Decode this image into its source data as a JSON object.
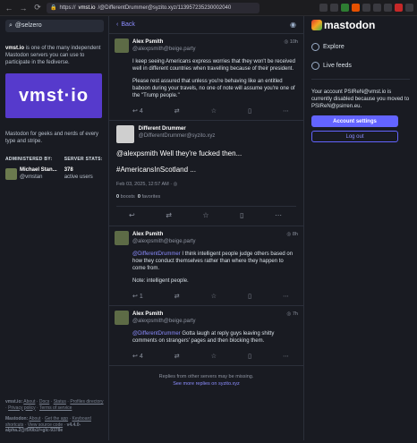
{
  "browser": {
    "url_prefix": "https://",
    "url_host": "vmst.io",
    "url_path": "/@DifferentDrummer@syzito.xyz/113957235230002040",
    "back": "←",
    "forward": "→",
    "reload": "⟳"
  },
  "sidebar": {
    "search_placeholder": "@selzero",
    "about_server": "vmst.io",
    "about_text": " is one of the many independent Mastodon servers you can use to participate in the fediverse.",
    "banner_text": "vmst·io",
    "banner_sub": "Mastodon for geeks and nerds of every type and stripe.",
    "administered_by_label": "ADMINISTERED BY:",
    "admin_name": "Michael Stan...",
    "admin_handle": "@vmstan",
    "server_stats_label": "SERVER STATS:",
    "active_users_count": "378",
    "active_users_label": "active users",
    "footer1": [
      "vmst.io:",
      "About",
      "Docs",
      "Status",
      "Profiles directory",
      "Privacy policy",
      "Terms of service"
    ],
    "footer2": [
      "Mastodon:",
      "About",
      "Get the app",
      "Keyboard shortcuts",
      "View source code",
      "v4.4.0-alpha.2@f5f0b1f+glc-9378e"
    ]
  },
  "column": {
    "back_label": "Back"
  },
  "posts": [
    {
      "name": "Alex Psmith",
      "handle": "@alexpsmith@beige.party",
      "time": "10h",
      "paragraphs": [
        "I keep seeing Americans express worries that they won't be received well in different countries when travelling because of their president.",
        "Please rest assured that unless you're behaving like an entitled baboon during your travels, no one of note will assume you're one of the \"Trump people.\""
      ],
      "replies": "4"
    }
  ],
  "focused": {
    "name": "Different Drummer",
    "handle": "@DifferentDrummer@syzito.xyz",
    "text1": "@alexpsmith Well they're fucked then...",
    "text2": "#AmericansInScotland ...",
    "timestamp": "Feb 03, 2025, 12:57 AM",
    "boosts_count": "0",
    "boosts_label": "boosts",
    "favorites_count": "0",
    "favorites_label": "favorites"
  },
  "replies": [
    {
      "name": "Alex Psmith",
      "handle": "@alexpsmith@beige.party",
      "time": "8h",
      "paragraphs": [
        "@DifferentDrummer I think intelligent people judge others based on how they conduct themselves rather than where they happen to come from.",
        "Note: intelligent people."
      ],
      "reply_count": "1"
    },
    {
      "name": "Alex Psmith",
      "handle": "@alexpsmith@beige.party",
      "time": "7h",
      "paragraphs": [
        "@DifferentDrummer Gotta laugh at reply guys leaving shitty comments on strangers' pages and then blocking them."
      ],
      "reply_count": "4"
    }
  ],
  "bottom_note": {
    "line1": "Replies from other servers may be missing.",
    "link": "See more replies on syzito.xyz"
  },
  "right": {
    "logo": "mastodon",
    "explore": "Explore",
    "live_feeds": "Live feeds",
    "disabled_note": "Your account PSIReN@vmst.io is currently disabled because you moved to PSIReN@psirren.eu.",
    "account_settings": "Account settings",
    "log_out": "Log out"
  }
}
